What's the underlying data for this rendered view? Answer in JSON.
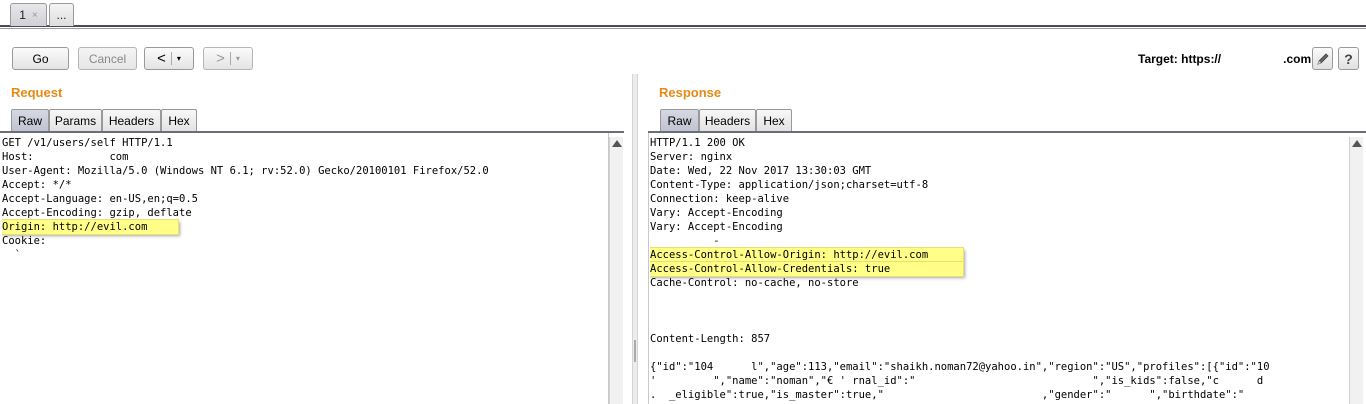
{
  "tabs": [
    {
      "label": "1",
      "close": "×"
    },
    {
      "label": "..."
    }
  ],
  "toolbar": {
    "go_label": "Go",
    "cancel_label": "Cancel",
    "back_arrow": "<",
    "forward_arrow": ">",
    "dropdown_glyph": "▾",
    "target_prefix": "Target: https://",
    "target_suffix": ".com",
    "help_label": "?"
  },
  "request": {
    "title": "Request",
    "tabs": [
      "Raw",
      "Params",
      "Headers",
      "Hex"
    ],
    "active_tab": "Raw",
    "lines": [
      "GET /v1/users/self HTTP/1.1",
      "Host:            com",
      "User-Agent: Mozilla/5.0 (Windows NT 6.1; rv:52.0) Gecko/20100101 Firefox/52.0",
      "Accept: */*",
      "Accept-Language: en-US,en;q=0.5",
      "Accept-Encoding: gzip, deflate",
      "Origin: http://evil.com",
      "Cookie:",
      "  `"
    ],
    "highlighted_line": "Origin: http://evil.com"
  },
  "response": {
    "title": "Response",
    "tabs": [
      "Raw",
      "Headers",
      "Hex"
    ],
    "active_tab": "Raw",
    "lines": [
      "HTTP/1.1 200 OK",
      "Server: nginx",
      "Date: Wed, 22 Nov 2017 13:30:03 GMT",
      "Content-Type: application/json;charset=utf-8",
      "Connection: keep-alive",
      "Vary: Accept-Encoding",
      "Vary: Accept-Encoding",
      "          -",
      "Access-Control-Allow-Origin: http://evil.com",
      "Access-Control-Allow-Credentials: true",
      "Cache-Control: no-cache, no-store",
      "",
      "",
      "",
      "Content-Length: 857",
      "",
      "{\"id\":\"104      l\",\"age\":113,\"email\":\"shaikh.noman72@yahoo.in\",\"region\":\"US\",\"profiles\":[{\"id\":\"10",
      "'         \",\"name\":\"noman\",\"€ ' rnal_id\":\"                            \",\"is_kids\":false,\"c      d",
      ".  _eligible\":true,\"is_master\":true,\"                         ,\"gender\":\"      \",\"birthdate\":\""
    ],
    "highlighted_lines": [
      "Access-Control-Allow-Origin: http://evil.com",
      "Access-Control-Allow-Credentials: true"
    ]
  },
  "colors": {
    "section_title": "#e58a15",
    "highlight": "#ffff88"
  }
}
